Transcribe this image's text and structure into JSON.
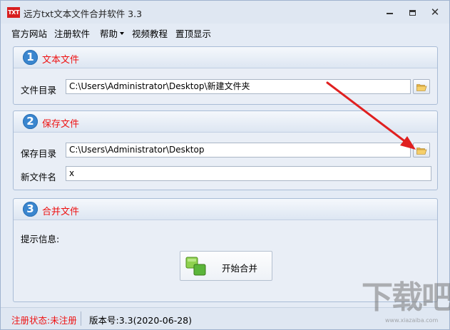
{
  "window": {
    "icon_text": "TXT",
    "title": "远方txt文本文件合并软件 3.3"
  },
  "menu": {
    "items": [
      {
        "label": "官方网站"
      },
      {
        "label": "注册软件"
      },
      {
        "label": "帮助"
      },
      {
        "label": "视频教程"
      },
      {
        "label": "置顶显示"
      }
    ]
  },
  "section1": {
    "number": "1",
    "title": "文本文件",
    "dir_label": "文件目录",
    "dir_value": "C:\\Users\\Administrator\\Desktop\\新建文件夹"
  },
  "section2": {
    "number": "2",
    "title": "保存文件",
    "dir_label": "保存目录",
    "dir_value": "C:\\Users\\Administrator\\Desktop",
    "name_label": "新文件名",
    "name_value": "x"
  },
  "section3": {
    "number": "3",
    "title": "合并文件",
    "info_label": "提示信息:",
    "merge_button": "开始合并"
  },
  "status": {
    "registration": "注册状态:未注册",
    "version": "版本号:3.3(2020-06-28)"
  },
  "watermark": {
    "text": "下载吧",
    "sub": "www.xiazaiba.com"
  },
  "colors": {
    "accent_red": "#ee1111",
    "badge_blue": "#3a86cf",
    "annotation_arrow": "#e02020"
  },
  "icons": {
    "folder": "folder-open-icon",
    "merge": "merge-files-icon"
  }
}
